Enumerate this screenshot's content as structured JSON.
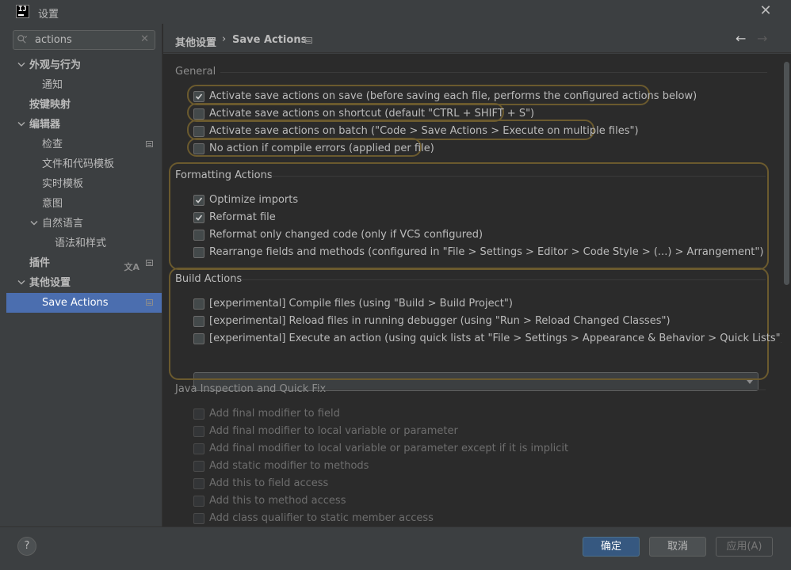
{
  "window": {
    "title": "设置",
    "app_icon_text": "IJ"
  },
  "search": {
    "value": "actions"
  },
  "sidebar": {
    "items": [
      {
        "label": "外观与行为",
        "level": 0,
        "expanded": true,
        "bold": true
      },
      {
        "label": "通知",
        "level": 1
      },
      {
        "label": "按键映射",
        "level": 0,
        "bold": true
      },
      {
        "label": "编辑器",
        "level": 0,
        "expanded": true,
        "bold": true
      },
      {
        "label": "检查",
        "level": 1,
        "marker": true
      },
      {
        "label": "文件和代码模板",
        "level": 1
      },
      {
        "label": "实时模板",
        "level": 1
      },
      {
        "label": "意图",
        "level": 1
      },
      {
        "label": "自然语言",
        "level": 1,
        "expanded": true
      },
      {
        "label": "语法和样式",
        "level": 2
      },
      {
        "label": "插件",
        "level": 0,
        "bold": true,
        "marker": true,
        "translate": true
      },
      {
        "label": "其他设置",
        "level": 0,
        "expanded": true,
        "bold": true
      },
      {
        "label": "Save Actions",
        "level": 1,
        "selected": true,
        "marker": true
      }
    ]
  },
  "breadcrumb": {
    "parent": "其他设置",
    "separator": "›",
    "current": "Save Actions"
  },
  "sections": {
    "general": {
      "title": "General",
      "options": [
        {
          "label": "Activate save actions on save (before saving each file, performs the configured actions below)",
          "checked": true
        },
        {
          "label": "Activate save actions on shortcut (default \"CTRL + SHIFT + S\")",
          "checked": false
        },
        {
          "label": "Activate save actions on batch (\"Code > Save Actions > Execute on multiple files\")",
          "checked": false
        },
        {
          "label": "No action if compile errors (applied per file)",
          "checked": false
        }
      ]
    },
    "formatting": {
      "title": "Formatting Actions",
      "options": [
        {
          "label": "Optimize imports",
          "checked": true
        },
        {
          "label": "Reformat file",
          "checked": true
        },
        {
          "label": "Reformat only changed code (only if VCS configured)",
          "checked": false
        },
        {
          "label": "Rearrange fields and methods (configured in \"File > Settings > Editor > Code Style > (...) > Arrangement\")",
          "checked": false
        }
      ]
    },
    "build": {
      "title": "Build Actions",
      "options": [
        {
          "label": "[experimental] Compile files (using \"Build > Build Project\")",
          "checked": false
        },
        {
          "label": "[experimental] Reload files in running debugger (using \"Run > Reload Changed Classes\")",
          "checked": false
        },
        {
          "label": "[experimental] Execute an action (using quick lists at \"File > Settings > Appearance & Behavior > Quick Lists\")",
          "checked": false
        }
      ],
      "combo_value": ""
    },
    "java": {
      "title": "Java Inspection and Quick Fix",
      "options": [
        {
          "label": "Add final modifier to field",
          "checked": false
        },
        {
          "label": "Add final modifier to local variable or parameter",
          "checked": false
        },
        {
          "label": "Add final modifier to local variable or parameter except if it is implicit",
          "checked": false
        },
        {
          "label": "Add static modifier to methods",
          "checked": false
        },
        {
          "label": "Add this to field access",
          "checked": false
        },
        {
          "label": "Add this to method access",
          "checked": false
        },
        {
          "label": "Add class qualifier to static member access",
          "checked": false
        }
      ]
    }
  },
  "buttons": {
    "help": "?",
    "ok": "确定",
    "cancel": "取消",
    "apply": "应用(A)"
  },
  "colors": {
    "selection": "#4b6eaf",
    "ok_button": "#365880",
    "highlight_outline": "#6b5a2e",
    "background": "#2b2b2b"
  }
}
